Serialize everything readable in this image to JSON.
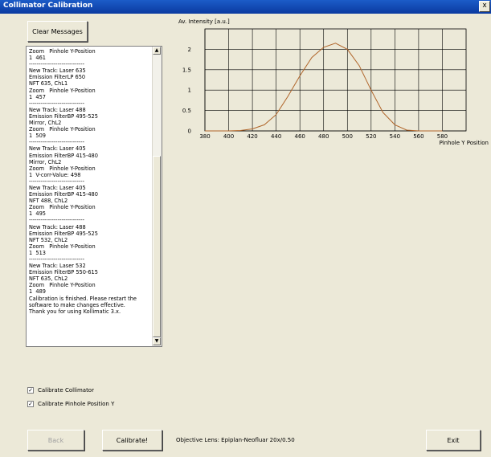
{
  "window": {
    "title": "Collimator Calibration",
    "close_label": "x"
  },
  "buttons": {
    "clear_messages": "Clear Messages",
    "back": "Back",
    "calibrate": "Calibrate!",
    "exit": "Exit"
  },
  "messages": "Zoom   Pinhole Y-Position\n1  461\n-----------------------------\nNew Track: Laser 635\nEmission FilterLP 650\nNFT 635, ChL1\nZoom   Pinhole Y-Position\n1  457\n-----------------------------\nNew Track: Laser 488\nEmission FilterBP 495-525\nMirror, ChL2\nZoom   Pinhole Y-Position\n1  509\n-----------------------------\nNew Track: Laser 405\nEmission FilterBP 415-480\nMirror, ChL2\nZoom   Pinhole Y-Position\n1  V-corr-Value: 498\n-----------------------------\nNew Track: Laser 405\nEmission FilterBP 415-480\nNFT 488, ChL2\nZoom   Pinhole Y-Position\n1  495\n-----------------------------\nNew Track: Laser 488\nEmission FilterBP 495-525\nNFT 532, ChL2\nZoom   Pinhole Y-Position\n1  513\n-----------------------------\nNew Track: Laser 532\nEmission FilterBP 550-615\nNFT 635, ChL2\nZoom   Pinhole Y-Position\n1  489\nCalibration is finished. Please restart the software to make changes effective.\nThank you for using Kollimatic 3.x.",
  "checkboxes": [
    {
      "label": "Calibrate Collimator",
      "checked": true
    },
    {
      "label": "Calibrate Pinhole Position Y",
      "checked": true
    }
  ],
  "objective_lens": "Objective Lens: Epiplan-Neofluar 20x/0.50",
  "colors": {
    "line": "#b0652a",
    "titlebar": "#0b3aa0",
    "background": "#ece9d8"
  },
  "chart_data": {
    "type": "line",
    "ylabel": "Av. Intensity [a.u.]",
    "xlabel": "Pinhole Y Position",
    "xlim": [
      380,
      600
    ],
    "ylim": [
      0,
      2.5
    ],
    "x_ticks": [
      "380",
      "400",
      "420",
      "440",
      "460",
      "480",
      "500",
      "520",
      "540",
      "560",
      "580"
    ],
    "y_ticks": [
      "0",
      "0.5",
      "1",
      "1.5",
      "2"
    ],
    "grid": true,
    "x": [
      380,
      390,
      400,
      410,
      420,
      430,
      440,
      450,
      460,
      470,
      480,
      490,
      500,
      510,
      520,
      530,
      540,
      550,
      560,
      570,
      580
    ],
    "y": [
      0,
      0,
      0,
      0.01,
      0.05,
      0.15,
      0.4,
      0.85,
      1.35,
      1.8,
      2.05,
      2.15,
      2.0,
      1.6,
      1.0,
      0.45,
      0.15,
      0.02,
      0,
      0,
      0
    ]
  }
}
